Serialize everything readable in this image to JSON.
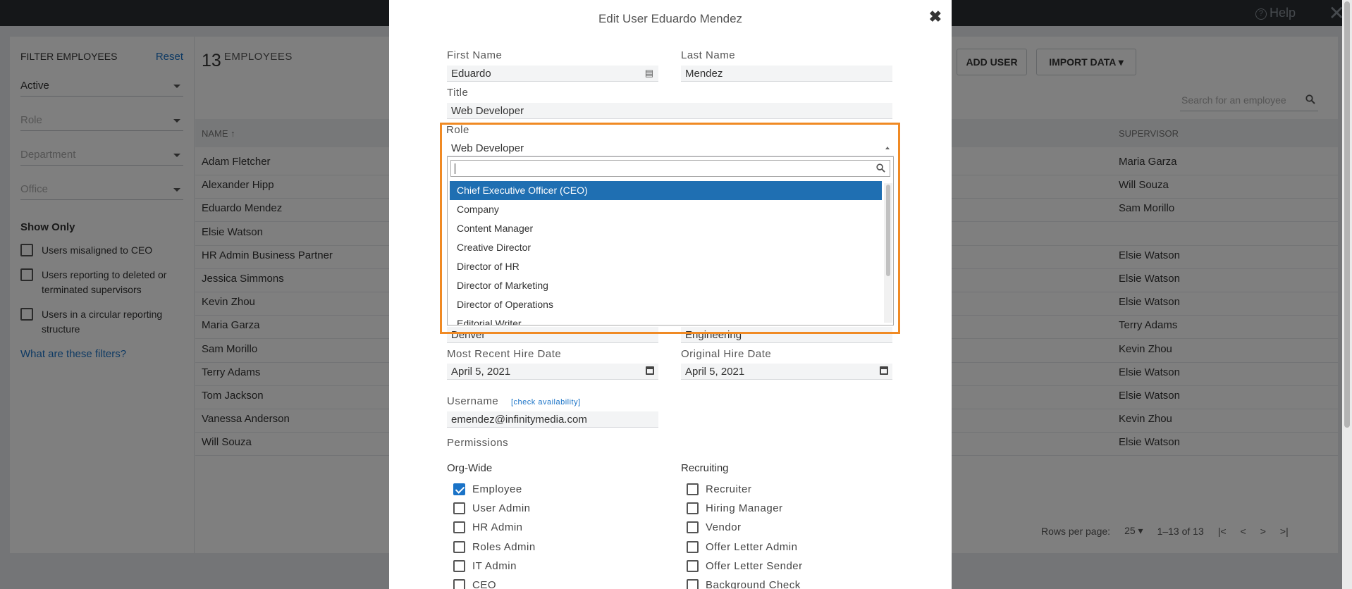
{
  "topbar": {
    "help_label": "Help",
    "close_glyph": "✕"
  },
  "filters": {
    "heading": "FILTER EMPLOYEES",
    "reset": "Reset",
    "status_value": "Active",
    "role_placeholder": "Role",
    "department_placeholder": "Department",
    "office_placeholder": "Office",
    "show_only_heading": "Show Only",
    "options": [
      "Users misaligned to CEO",
      "Users reporting to deleted or terminated supervisors",
      "Users in a circular reporting structure"
    ],
    "help_link": "What are these filters?"
  },
  "employees": {
    "count": "13",
    "count_label": "EMPLOYEES",
    "add_user": "ADD USER",
    "import_data": "IMPORT DATA ▾",
    "search_placeholder": "Search for an employee",
    "col_name": "NAME ↑",
    "col_supervisor": "SUPERVISOR",
    "rows": [
      {
        "name": "Adam Fletcher",
        "supervisor": "Maria Garza"
      },
      {
        "name": "Alexander Hipp",
        "supervisor": "Will Souza"
      },
      {
        "name": "Eduardo Mendez",
        "supervisor": "Sam Morillo"
      },
      {
        "name": "Elsie Watson",
        "supervisor": ""
      },
      {
        "name": "HR Admin Business Partner",
        "supervisor": "Elsie Watson"
      },
      {
        "name": "Jessica Simmons",
        "supervisor": "Elsie Watson"
      },
      {
        "name": "Kevin Zhou",
        "supervisor": "Elsie Watson"
      },
      {
        "name": "Maria Garza",
        "supervisor": "Terry Adams"
      },
      {
        "name": "Sam Morillo",
        "supervisor": "Kevin Zhou"
      },
      {
        "name": "Terry Adams",
        "supervisor": "Elsie Watson"
      },
      {
        "name": "Tom Jackson",
        "supervisor": "Elsie Watson"
      },
      {
        "name": "Vanessa Anderson",
        "supervisor": "Kevin Zhou"
      },
      {
        "name": "Will Souza",
        "supervisor": "Elsie Watson"
      }
    ],
    "rows_per_page_label": "Rows per page:",
    "rows_per_page": "25",
    "range": "1–13 of 13"
  },
  "modal": {
    "title": "Edit User Eduardo Mendez",
    "first_name_label": "First Name",
    "first_name": "Eduardo",
    "last_name_label": "Last Name",
    "last_name": "Mendez",
    "title_label": "Title",
    "title_value": "Web Developer",
    "role_label": "Role",
    "role_value": "Web Developer",
    "role_options": [
      "Chief Executive Officer (CEO)",
      "Company",
      "Content Manager",
      "Creative Director",
      "Director of HR",
      "Director of Marketing",
      "Director of Operations",
      "Editorial Writer"
    ],
    "role_selected_index": 0,
    "office_value": "Denver",
    "department_value": "Engineering",
    "recent_hire_label": "Most Recent Hire Date",
    "recent_hire": "April 5, 2021",
    "original_hire_label": "Original Hire Date",
    "original_hire": "April 5, 2021",
    "username_label": "Username",
    "check_availability": "[check availability]",
    "username": "emendez@infinitymedia.com",
    "permissions_label": "Permissions",
    "orgwide_label": "Org-Wide",
    "recruiting_label": "Recruiting",
    "orgwide": [
      {
        "label": "Employee",
        "checked": true
      },
      {
        "label": "User Admin",
        "checked": false
      },
      {
        "label": "HR Admin",
        "checked": false
      },
      {
        "label": "Roles Admin",
        "checked": false
      },
      {
        "label": "IT Admin",
        "checked": false
      },
      {
        "label": "CEO",
        "checked": false
      }
    ],
    "recruiting": [
      {
        "label": "Recruiter",
        "checked": false
      },
      {
        "label": "Hiring Manager",
        "checked": false
      },
      {
        "label": "Vendor",
        "checked": false
      },
      {
        "label": "Offer Letter Admin",
        "checked": false
      },
      {
        "label": "Offer Letter Sender",
        "checked": false
      },
      {
        "label": "Background Check",
        "checked": false
      }
    ]
  },
  "colors": {
    "accent": "#1a73c7",
    "highlight": "#f08a24",
    "selected": "#1f6fb2"
  }
}
